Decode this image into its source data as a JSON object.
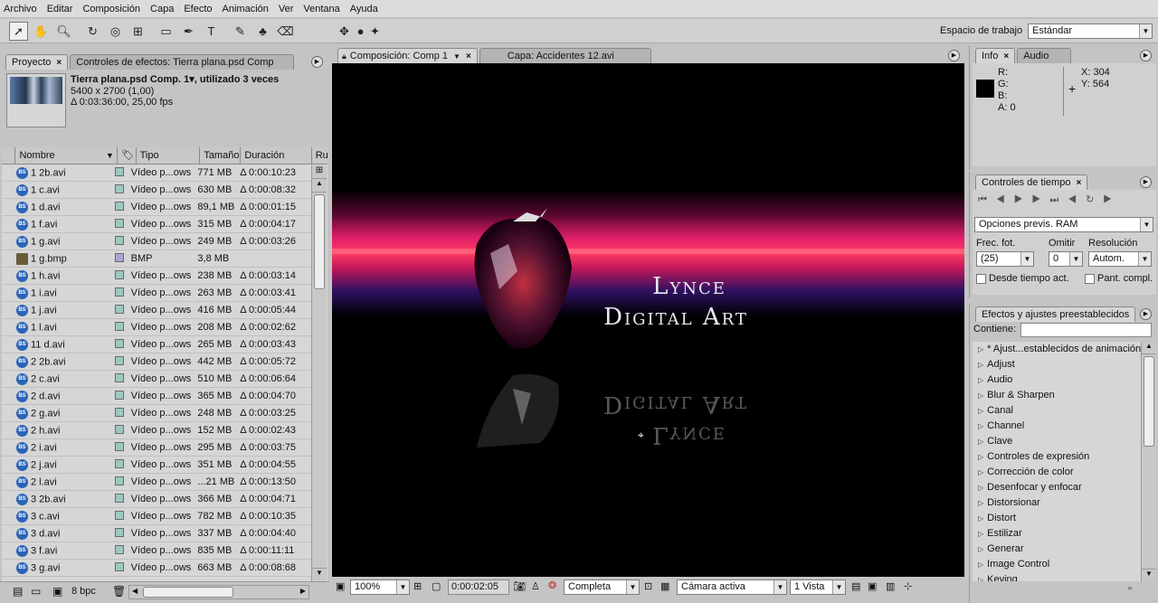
{
  "menu": [
    "Archivo",
    "Editar",
    "Composición",
    "Capa",
    "Efecto",
    "Animación",
    "Ver",
    "Ventana",
    "Ayuda"
  ],
  "toolbar": {
    "workspace_label": "Espacio de trabajo",
    "workspace_value": "Estándar"
  },
  "project": {
    "tab_project": "Proyecto",
    "tab_effects": "Controles de efectos: Tierra plana.psd Comp",
    "title": "Tierra plana.psd Comp. 1▾, utilizado 3 veces",
    "dims": "5400 x 2700 (1,00)",
    "duration": "Δ 0:03:36:00, 25,00 fps",
    "columns": [
      "Nombre",
      "Tipo",
      "Tamaño",
      "Duración",
      "Ru"
    ],
    "rows": [
      {
        "name": "1 2b.avi",
        "type": "Vídeo p...ows",
        "size": "771 MB",
        "dur": "Δ 0:00:10:23",
        "kind": "avi"
      },
      {
        "name": "1 c.avi",
        "type": "Vídeo p...ows",
        "size": "630 MB",
        "dur": "Δ 0:00:08:32",
        "kind": "avi"
      },
      {
        "name": "1 d.avi",
        "type": "Vídeo p...ows",
        "size": "89,1 MB",
        "dur": "Δ 0:00:01:15",
        "kind": "avi"
      },
      {
        "name": "1 f.avi",
        "type": "Vídeo p...ows",
        "size": "315 MB",
        "dur": "Δ 0:00:04:17",
        "kind": "avi"
      },
      {
        "name": "1 g.avi",
        "type": "Vídeo p...ows",
        "size": "249 MB",
        "dur": "Δ 0:00:03:26",
        "kind": "avi"
      },
      {
        "name": "1 g.bmp",
        "type": "BMP",
        "size": "3,8 MB",
        "dur": "",
        "kind": "bmp"
      },
      {
        "name": "1 h.avi",
        "type": "Vídeo p...ows",
        "size": "238 MB",
        "dur": "Δ 0:00:03:14",
        "kind": "avi"
      },
      {
        "name": "1 i.avi",
        "type": "Vídeo p...ows",
        "size": "263 MB",
        "dur": "Δ 0:00:03:41",
        "kind": "avi"
      },
      {
        "name": "1 j.avi",
        "type": "Vídeo p...ows",
        "size": "416 MB",
        "dur": "Δ 0:00:05:44",
        "kind": "avi"
      },
      {
        "name": "1 l.avi",
        "type": "Vídeo p...ows",
        "size": "208 MB",
        "dur": "Δ 0:00:02:62",
        "kind": "avi"
      },
      {
        "name": "11 d.avi",
        "type": "Vídeo p...ows",
        "size": "265 MB",
        "dur": "Δ 0:00:03:43",
        "kind": "avi"
      },
      {
        "name": "2 2b.avi",
        "type": "Vídeo p...ows",
        "size": "442 MB",
        "dur": "Δ 0:00:05:72",
        "kind": "avi"
      },
      {
        "name": "2 c.avi",
        "type": "Vídeo p...ows",
        "size": "510 MB",
        "dur": "Δ 0:00:06:64",
        "kind": "avi"
      },
      {
        "name": "2 d.avi",
        "type": "Vídeo p...ows",
        "size": "365 MB",
        "dur": "Δ 0:00:04:70",
        "kind": "avi"
      },
      {
        "name": "2 g.avi",
        "type": "Vídeo p...ows",
        "size": "248 MB",
        "dur": "Δ 0:00:03:25",
        "kind": "avi"
      },
      {
        "name": "2 h.avi",
        "type": "Vídeo p...ows",
        "size": "152 MB",
        "dur": "Δ 0:00:02:43",
        "kind": "avi"
      },
      {
        "name": "2 i.avi",
        "type": "Vídeo p...ows",
        "size": "295 MB",
        "dur": "Δ 0:00:03:75",
        "kind": "avi"
      },
      {
        "name": "2 j.avi",
        "type": "Vídeo p...ows",
        "size": "351 MB",
        "dur": "Δ 0:00:04:55",
        "kind": "avi"
      },
      {
        "name": "2 l.avi",
        "type": "Vídeo p...ows",
        "size": "...21 MB",
        "dur": "Δ 0:00:13:50",
        "kind": "avi"
      },
      {
        "name": "3 2b.avi",
        "type": "Vídeo p...ows",
        "size": "366 MB",
        "dur": "Δ 0:00:04:71",
        "kind": "avi"
      },
      {
        "name": "3 c.avi",
        "type": "Vídeo p...ows",
        "size": "782 MB",
        "dur": "Δ 0:00:10:35",
        "kind": "avi"
      },
      {
        "name": "3 d.avi",
        "type": "Vídeo p...ows",
        "size": "337 MB",
        "dur": "Δ 0:00:04:40",
        "kind": "avi"
      },
      {
        "name": "3 f.avi",
        "type": "Vídeo p...ows",
        "size": "835 MB",
        "dur": "Δ 0:00:11:11",
        "kind": "avi"
      },
      {
        "name": "3 g.avi",
        "type": "Vídeo p...ows",
        "size": "663 MB",
        "dur": "Δ 0:00:08:68",
        "kind": "avi"
      }
    ],
    "bpc": "8 bpc"
  },
  "composition": {
    "tab_comp": "Composición: Comp 1",
    "tab_layer": "Capa: Accidentes 12.avi",
    "logo_line1": "Lynce",
    "logo_line2": "Digital Art",
    "zoom": "100%",
    "timecode": "0:00:02:05",
    "resolution": "Completa",
    "camera": "Cámara activa",
    "views": "1 Vista"
  },
  "info": {
    "tab_info": "Info",
    "tab_audio": "Audio",
    "r": "R:",
    "g": "G:",
    "b": "B:",
    "a": "A:  0",
    "x": "X:  304",
    "y": "Y:  564"
  },
  "time_controls": {
    "tab": "Controles de tiempo",
    "ram_preview": "Opciones previs. RAM",
    "frame_rate_label": "Frec. fot.",
    "skip_label": "Omitir",
    "resolution_label": "Resolución",
    "frame_rate": "(25)",
    "skip": "0",
    "resolution": "Autom.",
    "from_current": "Desde tiempo act.",
    "full_screen": "Pant. compl."
  },
  "effects": {
    "tab": "Efectos y ajustes preestablecidos",
    "contains_label": "Contiene:",
    "items": [
      "* Ajust...establecidos de animación",
      "Adjust",
      "Audio",
      "Blur & Sharpen",
      "Canal",
      "Channel",
      "Clave",
      "Controles de expresión",
      "Corrección de color",
      "Desenfocar y enfocar",
      "Distorsionar",
      "Distort",
      "Estilizar",
      "Generar",
      "Image Control",
      "Keying"
    ]
  }
}
